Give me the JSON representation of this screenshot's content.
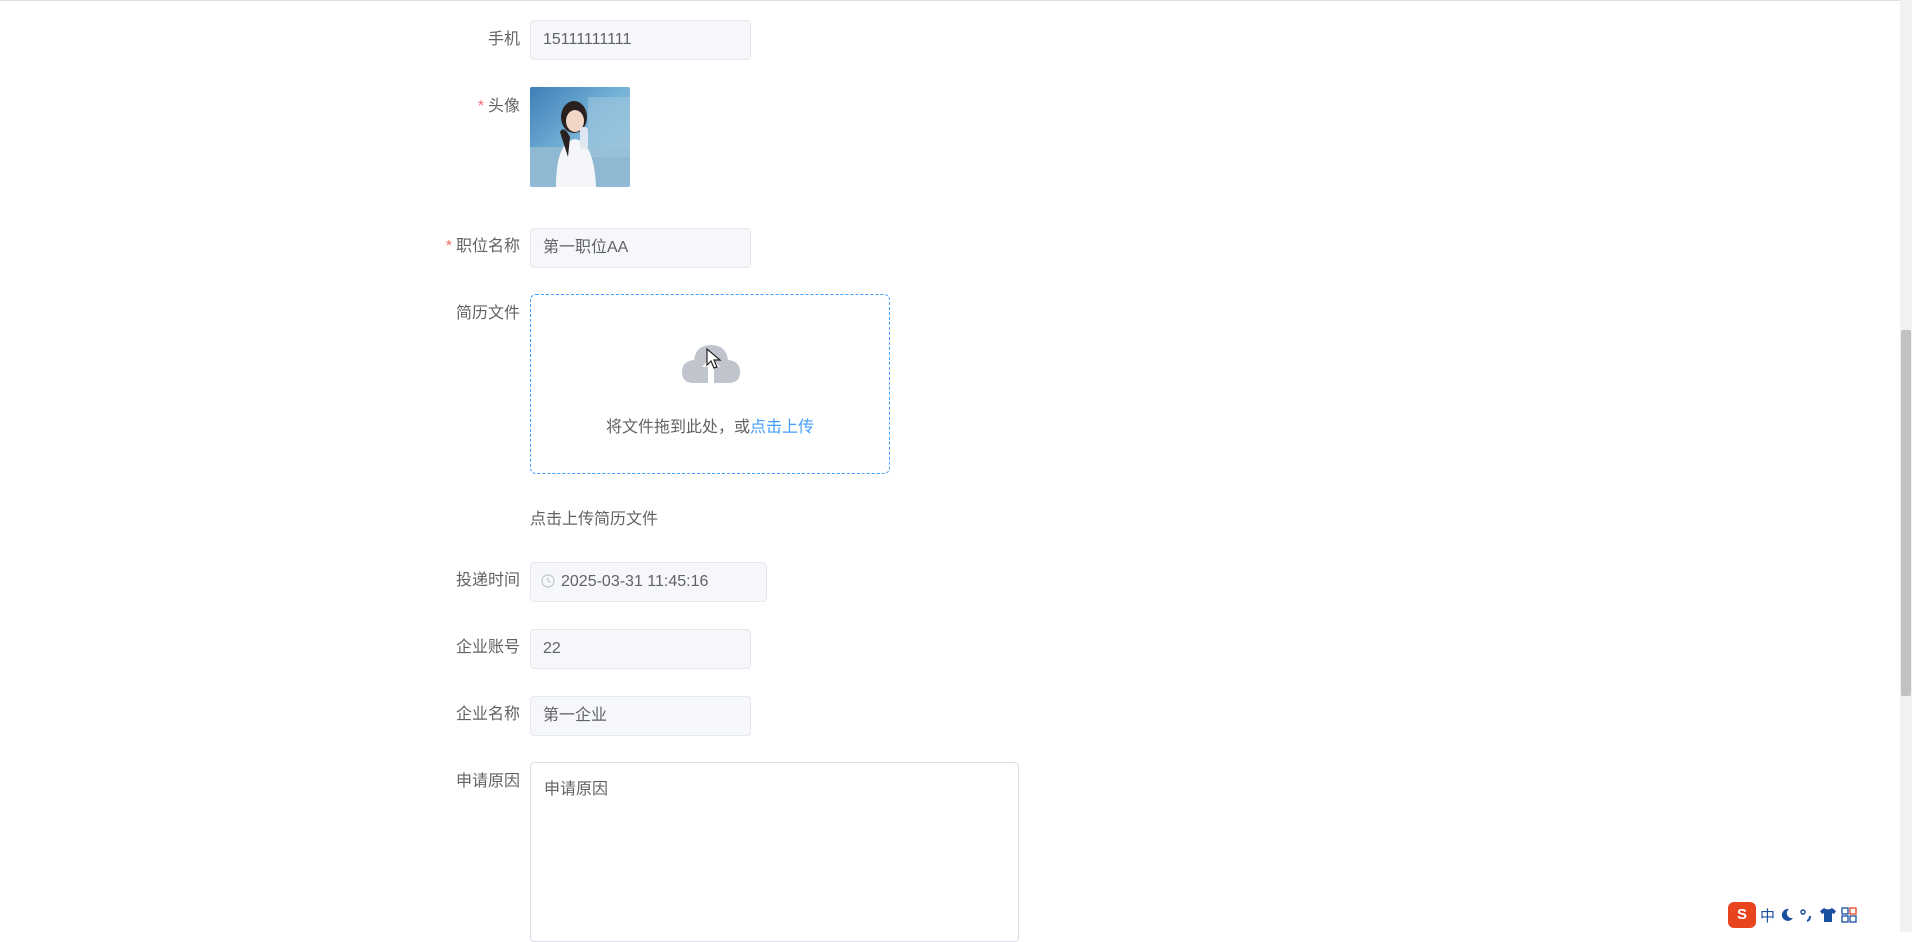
{
  "form": {
    "phone": {
      "label": "手机",
      "value": "15111111111"
    },
    "avatar": {
      "label": "头像",
      "required_mark": "*"
    },
    "position": {
      "label": "职位名称",
      "required_mark": "*",
      "value": "第一职位AA"
    },
    "resume": {
      "label": "简历文件",
      "drag_text": "将文件拖到此处，或",
      "click_text": "点击上传",
      "tip": "点击上传简历文件"
    },
    "submit_time": {
      "label": "投递时间",
      "value": "2025-03-31 11:45:16"
    },
    "company_account": {
      "label": "企业账号",
      "value": "22"
    },
    "company_name": {
      "label": "企业名称",
      "value": "第一企业"
    },
    "reason": {
      "label": "申请原因",
      "value": "申请原因"
    }
  },
  "ime_toolbar": {
    "logo": "S",
    "mode": "中",
    "items": [
      "moon-icon",
      "punctuation-icon",
      "shirt-icon",
      "grid-icon"
    ]
  },
  "colors": {
    "primary": "#409eff",
    "required": "#f56c6c",
    "disabled_bg": "#f5f7fa"
  }
}
